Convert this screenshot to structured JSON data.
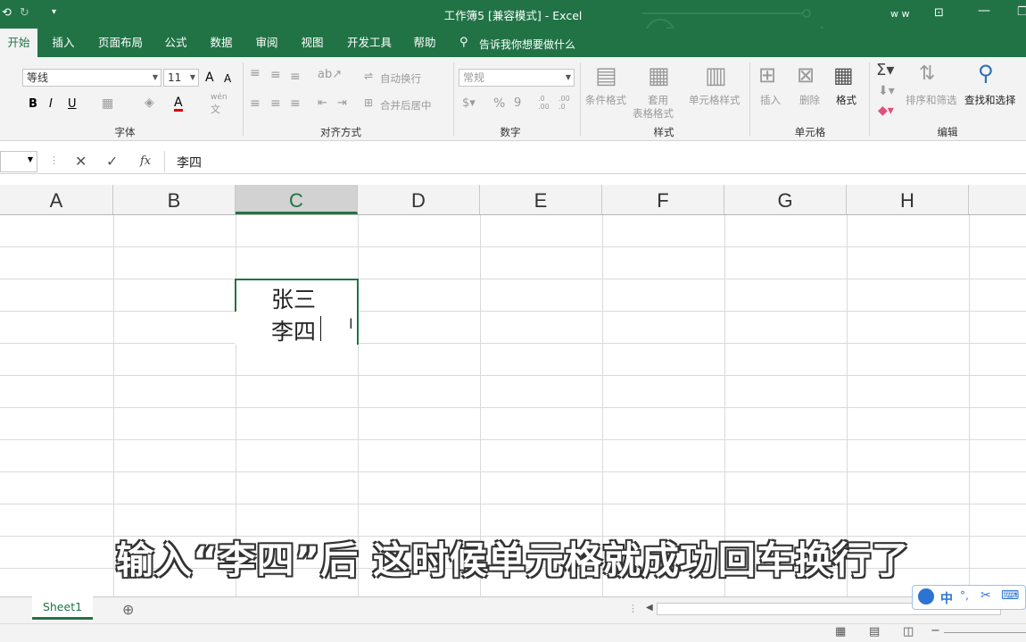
{
  "titlebar": {
    "title": "工作簿5  [兼容模式]  -  Excel",
    "user": "w w"
  },
  "tabs": [
    "开始",
    "插入",
    "页面布局",
    "公式",
    "数据",
    "审阅",
    "视图",
    "开发工具",
    "帮助"
  ],
  "tell_me": "告诉我你想要做什么",
  "ribbon": {
    "font_name": "等线",
    "font_size": "11",
    "grow_font": "A",
    "shrink_font": "A",
    "bold": "B",
    "italic": "I",
    "underline": "U",
    "font_color_letter": "A",
    "wen": "wén",
    "wen_char": "文",
    "wrap_text": "自动换行",
    "merge_center": "合并后居中",
    "number_format": "常规",
    "percent": "%",
    "thousands": "9",
    "inc_decimal": ".0 .00",
    "dec_decimal": ".00 .0",
    "cond_format": "条件格式",
    "table_format_1": "套用",
    "table_format_2": "表格格式",
    "cell_styles": "单元格样式",
    "insert": "插入",
    "delete": "删除",
    "format": "格式",
    "sort_filter": "排序和筛选",
    "find_select": "查找和选择",
    "groups": {
      "font": "字体",
      "align": "对齐方式",
      "number": "数字",
      "styles": "样式",
      "cells": "单元格",
      "editing": "编辑"
    }
  },
  "formula_bar": {
    "fx": "fx",
    "content": "李四"
  },
  "columns": [
    "A",
    "B",
    "C",
    "D",
    "E",
    "F",
    "G",
    "H"
  ],
  "selected_column": "C",
  "cell_c": {
    "line1": "张三",
    "line2": "李四"
  },
  "subtitle": "输入“李四”后 这时候单元格就成功回车换行了",
  "sheet_tab": "Sheet1",
  "ime": {
    "mode": "中",
    "punct": "°,"
  },
  "colors": {
    "excel_green": "#217346",
    "ribbon_bg": "#f3f3f3",
    "selection": "#217346"
  }
}
